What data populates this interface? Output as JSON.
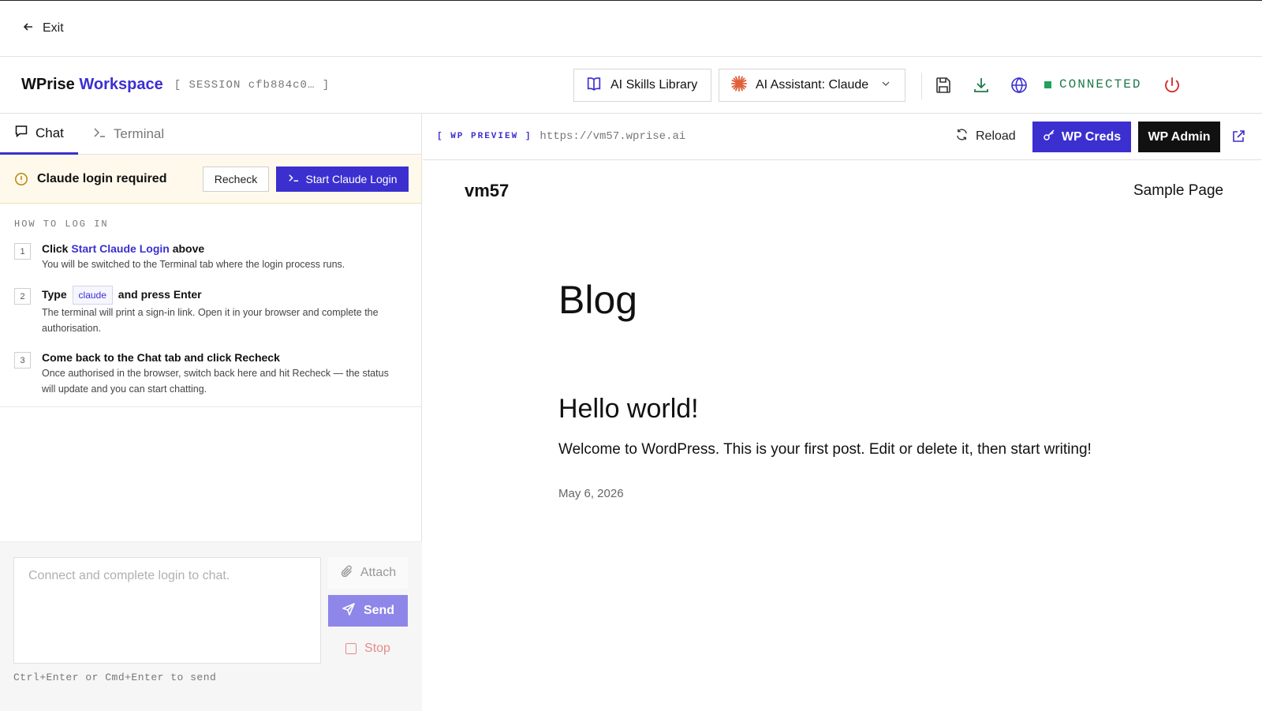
{
  "topbar": {
    "exit_label": "Exit"
  },
  "header": {
    "brand_main": "WPrise",
    "brand_accent": "Workspace",
    "session": "[ SESSION cfb884c0… ]",
    "skills_label": "AI Skills Library",
    "assistant_label": "AI Assistant: Claude",
    "status": "CONNECTED",
    "colors": {
      "accent": "#3b2fd0",
      "connected": "#1d7a4a",
      "power": "#d32f2f"
    }
  },
  "left": {
    "tabs": [
      {
        "label": "Chat"
      },
      {
        "label": "Terminal"
      }
    ],
    "alert": {
      "title": "Claude login required",
      "recheck_label": "Recheck",
      "start_label": "Start Claude Login"
    },
    "howto": {
      "title": "HOW TO LOG IN",
      "steps": [
        {
          "num": "1",
          "pre": "Click ",
          "link": "Start Claude Login",
          "post": " above",
          "desc": "You will be switched to the Terminal tab where the login process runs."
        },
        {
          "num": "2",
          "pre": "Type ",
          "code": "claude",
          "post": " and press Enter",
          "desc": "The terminal will print a sign-in link. Open it in your browser and complete the authorisation."
        },
        {
          "num": "3",
          "head": "Come back to the Chat tab and click Recheck",
          "desc": "Once authorised in the browser, switch back here and hit Recheck — the status will update and you can start chatting."
        }
      ]
    },
    "composer": {
      "placeholder": "Connect and complete login to chat.",
      "attach_label": "Attach",
      "send_label": "Send",
      "stop_label": "Stop",
      "hint": "Ctrl+Enter or Cmd+Enter to send"
    }
  },
  "preview": {
    "tag": "[ WP PREVIEW ]",
    "url": "https://vm57.wprise.ai",
    "reload_label": "Reload",
    "creds_label": "WP Creds",
    "admin_label": "WP Admin",
    "site": {
      "name": "vm57",
      "nav_item": "Sample Page",
      "blog_title": "Blog",
      "post_title": "Hello world!",
      "post_body": "Welcome to WordPress. This is your first post. Edit or delete it, then start writing!",
      "post_date": "May 6, 2026"
    }
  }
}
